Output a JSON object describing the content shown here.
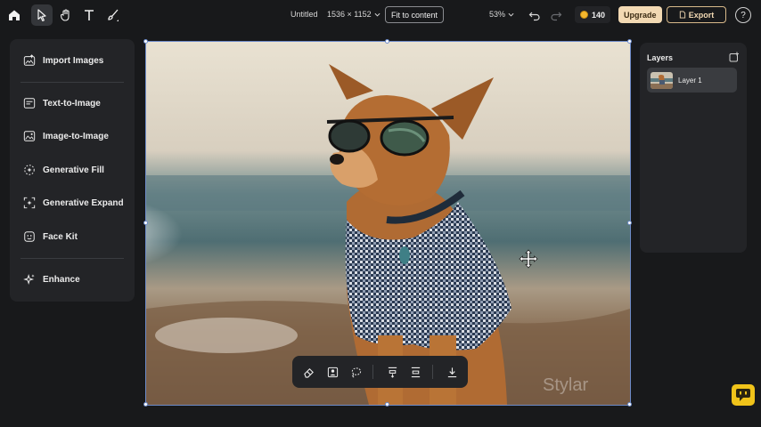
{
  "topbar": {
    "home_icon": "home-icon",
    "tools": [
      "select-arrow-icon",
      "hand-icon",
      "text-icon",
      "brush-icon"
    ],
    "doc_title": "Untitled",
    "doc_size": "1536 × 1152",
    "fit_label": "Fit to content",
    "zoom": "53%",
    "credits": "140",
    "upgrade_label": "Upgrade",
    "export_label": "Export",
    "help_label": "?"
  },
  "tools_panel": {
    "items": [
      {
        "label": "Import Images",
        "icon": "import-images-icon"
      },
      {
        "label": "Text-to-Image",
        "icon": "text-to-image-icon"
      },
      {
        "label": "Image-to-Image",
        "icon": "image-to-image-icon"
      },
      {
        "label": "Generative Fill",
        "icon": "generative-fill-icon"
      },
      {
        "label": "Generative Expand",
        "icon": "generative-expand-icon"
      },
      {
        "label": "Face Kit",
        "icon": "face-kit-icon"
      },
      {
        "label": "Enhance",
        "icon": "enhance-icon"
      }
    ]
  },
  "canvas": {
    "watermark": "Stylar",
    "subject": "dog-with-sunglasses-beach-image"
  },
  "float_toolbar": {
    "buttons": [
      "eraser-icon",
      "remove-background-icon",
      "lasso-select-icon",
      "align-top-icon",
      "align-middle-icon",
      "download-icon"
    ]
  },
  "layers": {
    "title": "Layers",
    "items": [
      {
        "name": "Layer 1"
      }
    ]
  },
  "colors": {
    "background": "#18191b",
    "panel": "#232427",
    "accent_gold": "#f2d9b3",
    "coin": "#f5b82e",
    "selection": "#6d8bc9",
    "chat": "#f0c31a"
  }
}
